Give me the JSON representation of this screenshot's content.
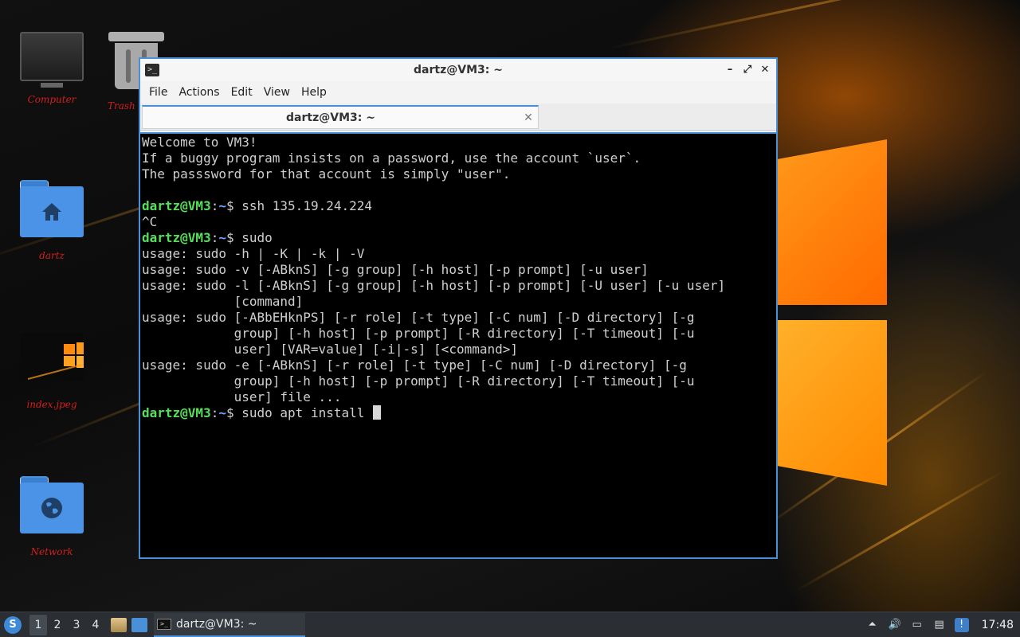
{
  "desktop": {
    "icons": [
      {
        "label": "Computer"
      },
      {
        "label": "Trash ("
      },
      {
        "label": "dartz"
      },
      {
        "label": "index.jpeg"
      },
      {
        "label": "Network"
      }
    ]
  },
  "window": {
    "title": "dartz@VM3: ~",
    "app_icon_glyph": ">_",
    "controls": {
      "minimize": "–",
      "maximize": "⤢",
      "close": "✕"
    },
    "menu": [
      "File",
      "Actions",
      "Edit",
      "View",
      "Help"
    ],
    "tab": {
      "title": "dartz@VM3: ~",
      "close": "✕"
    }
  },
  "terminal": {
    "prompt_user": "dartz@VM3",
    "prompt_sep": ":",
    "prompt_path": "~",
    "prompt_dollar": "$ ",
    "lines": [
      "Welcome to VM3!",
      "If a buggy program insists on a password, use the account `user`.",
      "The passsword for that account is simply \"user\".",
      "",
      "ssh 135.19.24.224",
      "^C",
      "sudo",
      "usage: sudo -h | -K | -k | -V",
      "usage: sudo -v [-ABknS] [-g group] [-h host] [-p prompt] [-u user]",
      "usage: sudo -l [-ABknS] [-g group] [-h host] [-p prompt] [-U user] [-u user]",
      "            [command]",
      "usage: sudo [-ABbEHknPS] [-r role] [-t type] [-C num] [-D directory] [-g",
      "            group] [-h host] [-p prompt] [-R directory] [-T timeout] [-u",
      "            user] [VAR=value] [-i|-s] [<command>]",
      "usage: sudo -e [-ABknS] [-r role] [-t type] [-C num] [-D directory] [-g",
      "            group] [-h host] [-p prompt] [-R directory] [-T timeout] [-u",
      "            user] file ...",
      "sudo apt install "
    ]
  },
  "taskbar": {
    "start_glyph": "S",
    "workspaces": [
      "1",
      "2",
      "3",
      "4"
    ],
    "active_task": {
      "title": "dartz@VM3: ~",
      "glyph": ">_"
    },
    "tray_glyphs": {
      "up": "⏶",
      "volume": "🔊",
      "network": "▭",
      "clipboard": "▤",
      "update": "!"
    },
    "clock": "17:48"
  },
  "colors": {
    "accent": "#4a90d9",
    "prompt_user": "#55e05a",
    "prompt_path": "#6aa7ff",
    "desktop_label": "#d21f1f"
  }
}
